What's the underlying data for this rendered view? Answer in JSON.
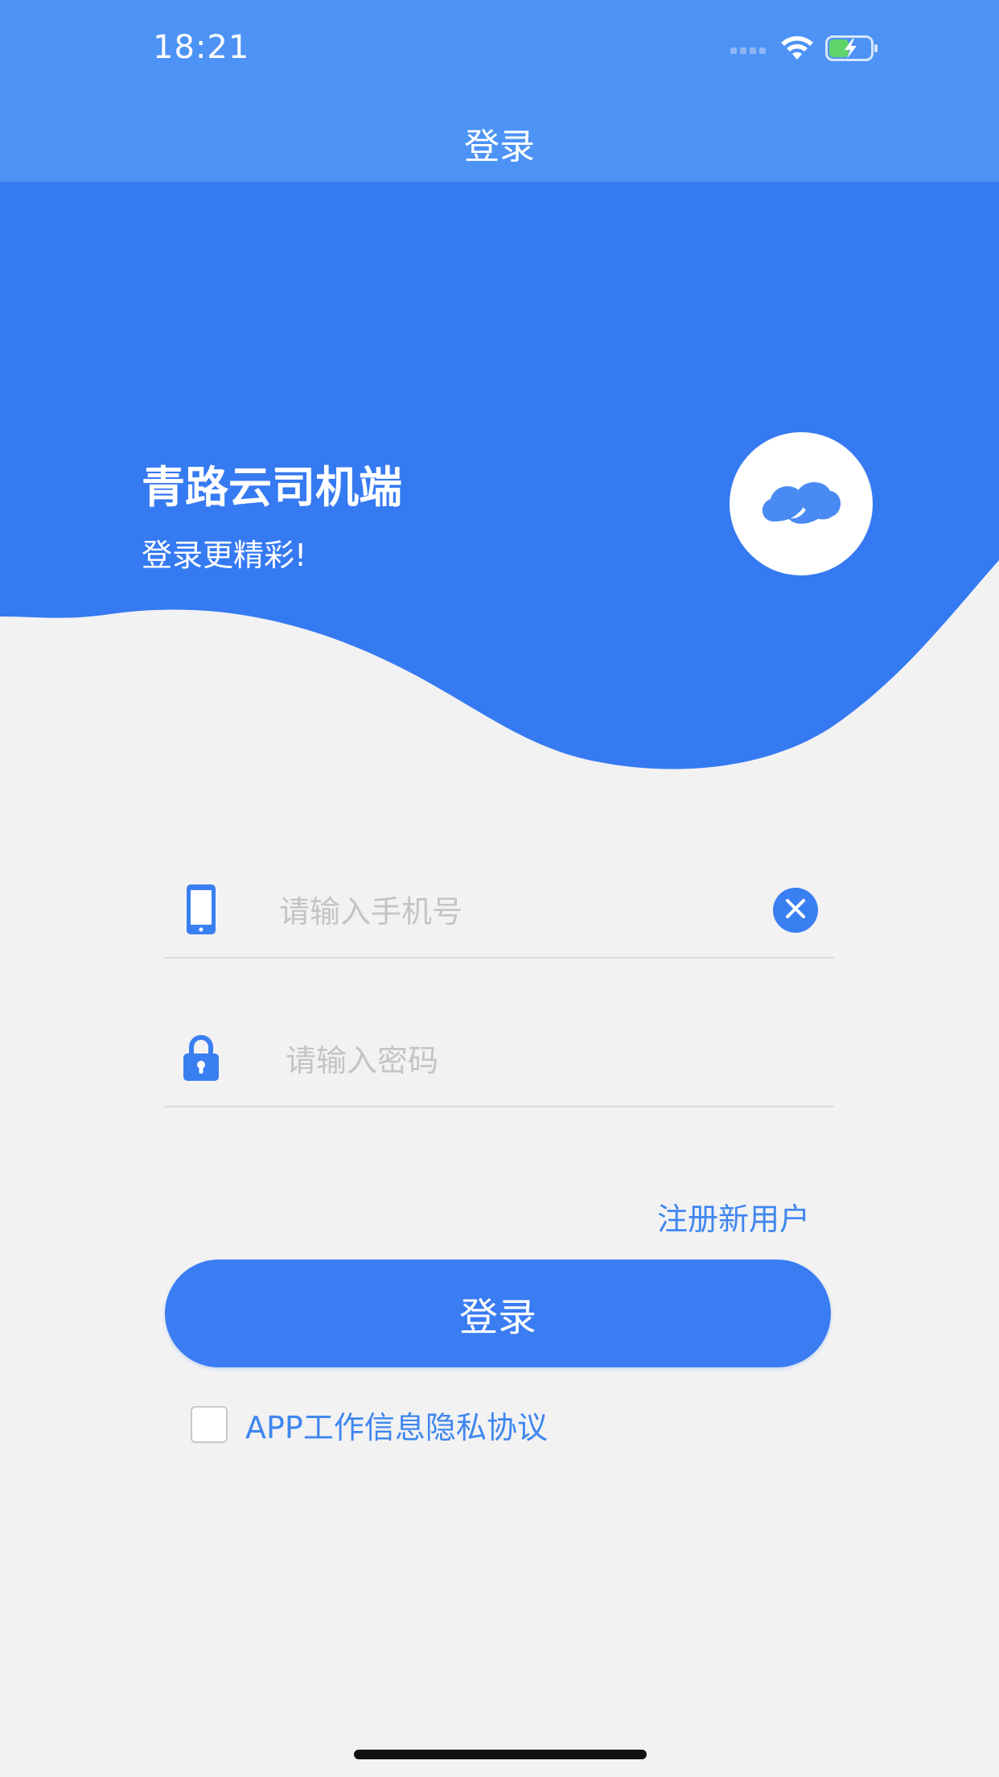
{
  "status_bar": {
    "time": "18:21",
    "icons": [
      "signal-icon",
      "wifi-icon",
      "battery-charging-icon"
    ]
  },
  "nav": {
    "title": "登录"
  },
  "hero": {
    "app_name": "青路云司机端",
    "slogan": "登录更精彩!",
    "logo_icon": "cloud-logo-icon"
  },
  "form": {
    "phone": {
      "value": "",
      "placeholder": "请输入手机号",
      "icon": "phone-icon",
      "clear_icon": "clear-icon"
    },
    "password": {
      "value": "",
      "placeholder": "请输入密码",
      "icon": "lock-icon"
    },
    "register_link": "注册新用户",
    "login_button": "登录",
    "agreement": {
      "checked": false,
      "text": "APP工作信息隐私协议"
    }
  },
  "colors": {
    "top_bar": "#4d93f5",
    "hero_blue": "#367af2",
    "accent": "#3a7ff2",
    "background": "#f2f2f3"
  }
}
